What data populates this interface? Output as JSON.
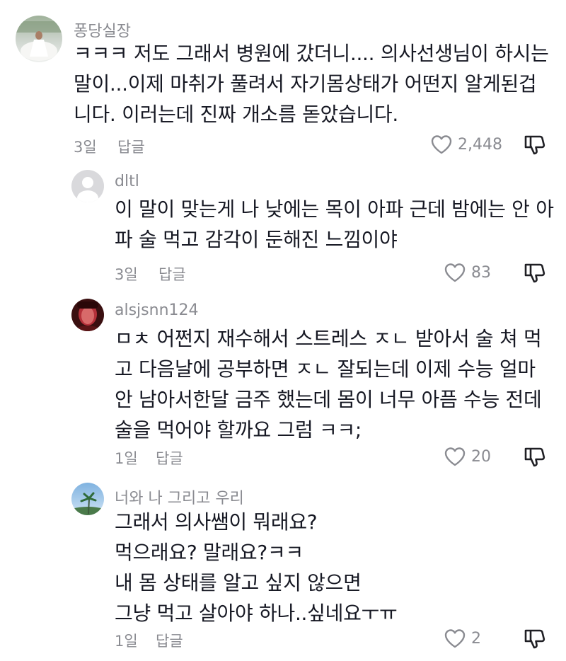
{
  "colors": {
    "text": "#161823",
    "muted": "#8a8b91",
    "background": "#ffffff"
  },
  "comments": [
    {
      "username": "퐁당실장",
      "lines": [
        "ㅋㅋㅋ 저도 그래서 병원에 갔더니.... 의사선생님이 하시는",
        "말이...이제 마취가 풀려서 자기몸상태가 어떤지 알게된겁",
        "니다. 이러는데 진짜 개소름 돋았습니다."
      ],
      "time": "3일",
      "reply_label": "답글",
      "likes": "2,448",
      "avatar": "photo"
    },
    {
      "username": "dltl",
      "lines": [
        "이 말이 맞는게 나 낮에는 목이 아파 근데 밤에는 안 아",
        "파 술 먹고 감각이 둔해진 느낌이야"
      ],
      "time": "3일",
      "reply_label": "답글",
      "likes": "83",
      "avatar": "default"
    },
    {
      "username": "alsjsnn124",
      "lines": [
        "ㅁㅊ 어쩐지 재수해서 스트레스 ㅈㄴ 받아서 술 쳐 먹",
        "고 다음날에 공부하면 ㅈㄴ 잘되는데 이제 수능 얼마",
        "안 남아서한달 금주 했는데 몸이 너무 아픔 수능 전데",
        "술을 먹어야 할까요 그럼 ㅋㅋ;"
      ],
      "time": "1일",
      "reply_label": "답글",
      "likes": "20",
      "avatar": "photo-red"
    },
    {
      "username": "너와 나 그리고 우리",
      "lines": [
        "그래서 의사쌤이 뭐래요?",
        "먹으래요? 말래요?ㅋㅋ",
        "내 몸 상태를 알고 싶지 않으면",
        "그냥 먹고 살아야 하나..싶네요ㅜㅠ"
      ],
      "time": "1일",
      "reply_label": "답글",
      "likes": "2",
      "avatar": "photo-sky"
    }
  ]
}
